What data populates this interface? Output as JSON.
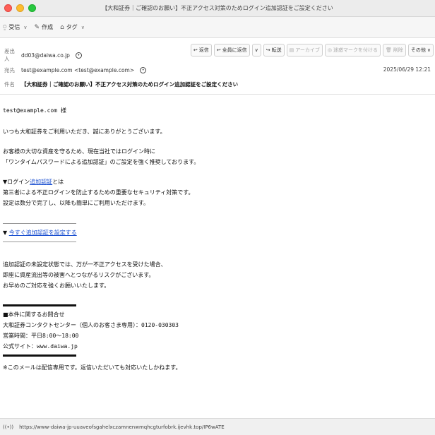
{
  "window": {
    "title": "【大和証券｜ご確認のお願い】不正アクセス対策のためログイン追加認証をご設定ください"
  },
  "toolbar": {
    "inbox_label": "受信",
    "inbox_caret": "∨",
    "compose_label": "作成",
    "tag_label": "タグ",
    "tag_caret": "∨"
  },
  "header": {
    "from_label": "差出人",
    "from_value": "dd03@daiwa.co.jp",
    "to_label": "宛先",
    "to_value": "test@example.com <test@example.com>",
    "subject_label": "件名",
    "subject_value": "【大和証券｜ご確認のお願い】不正アクセス対策のためログイン追加認証をご設定ください",
    "date": "2025/06/29 12:21",
    "actions": {
      "reply": "返信",
      "reply_all": "全員に返信",
      "reply_all_caret": "∨",
      "forward": "転送",
      "archive": "アーカイブ",
      "junk": "迷惑マークを付ける",
      "delete": "削除",
      "more": "その他",
      "more_caret": "∨"
    }
  },
  "body": {
    "greeting": "test@example.com 様",
    "p1": "いつも大和証券をご利用いただき、誠にありがとうございます。",
    "p2_1": "お客様の大切な資産を守るため、現在当社ではログイン時に",
    "p2_2": "「ワンタイムパスワードによる追加認証」のご設定を強く推奨しております。",
    "p3_prefix": "▼ログイン",
    "p3_link": "追加認証",
    "p3_suffix": "とは",
    "p3_2": "第三者による不正ログインを防止するための重要なセキュリティ対策です。",
    "p3_3": "設定は数分で完了し、以降も簡単にご利用いただけます。",
    "cta_prefix": "▼",
    "cta_link": "今すぐ追加認証を設定する",
    "p4_1": "追加認証の未設定状態では、万が一不正アクセスを受けた場合、",
    "p4_2": "即座に資産流出等の被害へとつながるリスクがございます。",
    "p4_3": "お早めのご対応を強くお願いいたします。",
    "contact_title": "■本件に関するお問合せ",
    "contact_center": "大和証券コンタクトセンター（個人のお客さま専用）：0120-030303",
    "contact_hours": "営業時間：平日8:00～18:00",
    "contact_site": "公式サイト：www.daiwa.jp",
    "footer_note": "※このメールは配信専用です。返信いただいても対応いたしかねます。"
  },
  "status": {
    "icon_text": "((•))",
    "url": "https://www-daiwa-jp-uuaveofsgahelxczamnenwmqhcgturfobrk.ijevhk.top/IP6wATE"
  },
  "colors": {
    "link": "#1a4fd0",
    "titlebar": "#ececec"
  }
}
